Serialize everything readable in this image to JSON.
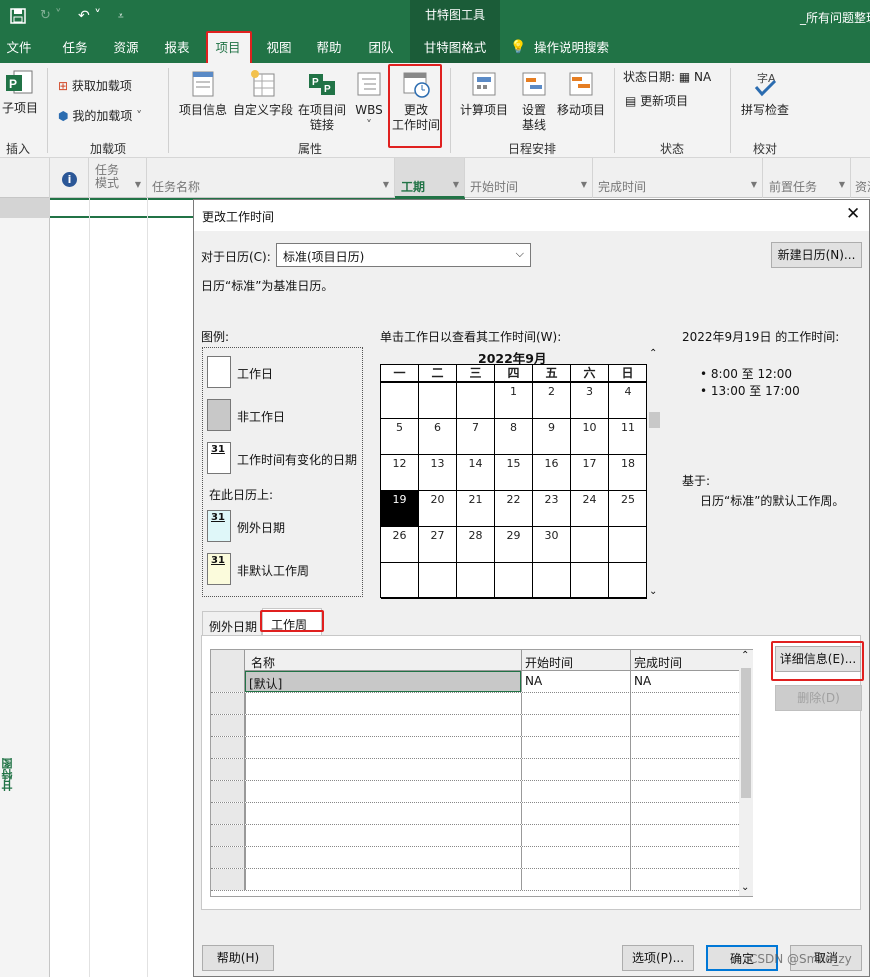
{
  "titlebar": {
    "context_title": "甘特图工具",
    "file_title": "_所有问题整理"
  },
  "menu": {
    "tabs": [
      "文件",
      "任务",
      "资源",
      "报表",
      "项目",
      "视图",
      "帮助",
      "团队",
      "甘特图格式"
    ],
    "search": "操作说明搜索"
  },
  "ribbon": {
    "subproject": "子项目",
    "get_addins": "获取加载项",
    "my_addins": "我的加载项",
    "project_info": "项目信息",
    "custom_fields": "自定义字段",
    "links_line1": "在项目间",
    "links_line2": "链接",
    "wbs": "WBS",
    "change_time_line1": "更改",
    "change_time_line2": "工作时间",
    "calc_project": "计算项目",
    "set_baseline_line1": "设置",
    "set_baseline_line2": "基线",
    "move_project": "移动项目",
    "status_date_label": "状态日期:",
    "status_date_value": "NA",
    "update_project": "更新项目",
    "spelling": "拼写检查",
    "groups": {
      "insert": "插入",
      "addins": "加载项",
      "properties": "属性",
      "schedule": "日程安排",
      "status": "状态",
      "proofing": "校对"
    }
  },
  "sheet": {
    "columns": [
      "任务",
      "模式",
      "任务名称",
      "工期",
      "开始时间",
      "完成时间",
      "前置任务",
      "资源"
    ],
    "side_label": "甘特图"
  },
  "dialog": {
    "title": "更改工作时间",
    "for_calendar_label": "对于日历(C):",
    "calendar_select": "标准(项目日历)",
    "new_calendar_button": "新建日历(N)...",
    "base_note": "日历“标准”为基准日历。",
    "legend_title": "图例:",
    "legend": {
      "workday": "工作日",
      "nonworkday": "非工作日",
      "changed": "工作时间有变化的日期",
      "on_this_calendar": "在此日历上:",
      "exception": "例外日期",
      "nondefault": "非默认工作周",
      "day_num": "31"
    },
    "click_hint": "单击工作日以查看其工作时间(W):",
    "month": "2022年9月",
    "weekdays": [
      "一",
      "二",
      "三",
      "四",
      "五",
      "六",
      "日"
    ],
    "weeks": [
      [
        "",
        "",
        "",
        "1",
        "2",
        "3",
        "4"
      ],
      [
        "5",
        "6",
        "7",
        "8",
        "9",
        "10",
        "11"
      ],
      [
        "12",
        "13",
        "14",
        "15",
        "16",
        "17",
        "18"
      ],
      [
        "19",
        "20",
        "21",
        "22",
        "23",
        "24",
        "25"
      ],
      [
        "26",
        "27",
        "28",
        "29",
        "30",
        "",
        ""
      ],
      [
        "",
        "",
        "",
        "",
        "",
        "",
        ""
      ]
    ],
    "selected_day": "19",
    "work_time_title": "2022年9月19日 的工作时间:",
    "work_times": [
      "8:00 至 12:00",
      "13:00 至 17:00"
    ],
    "based_on_label": "基于:",
    "based_on_text": "日历“标准”的默认工作周。",
    "tabs": [
      "例外日期",
      "工作周"
    ],
    "table_headers": [
      "名称",
      "开始时间",
      "完成时间"
    ],
    "table_rows": [
      [
        "[默认]",
        "NA",
        "NA"
      ]
    ],
    "details_button": "详细信息(E)...",
    "delete_button": "删除(D)",
    "help_button": "帮助(H)",
    "options_button": "选项(P)...",
    "ok_button": "确定",
    "cancel_button": "取消",
    "watermark": "CSDN @Smile_zy"
  }
}
